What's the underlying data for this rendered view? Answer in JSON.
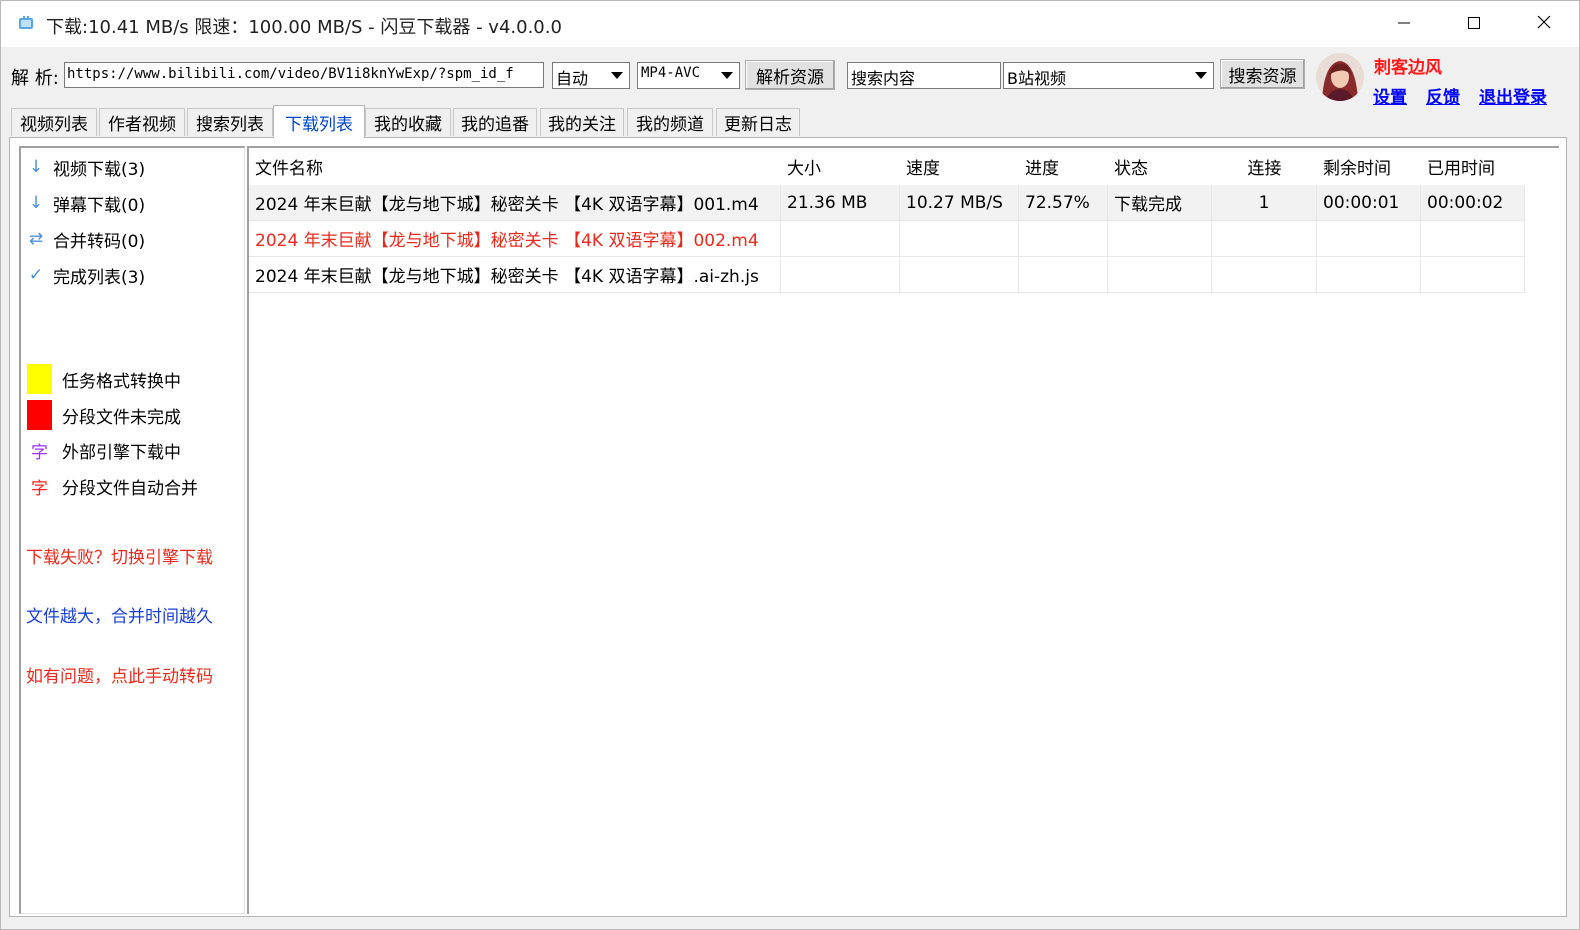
{
  "window": {
    "title": "下载:10.41 MB/s  限速：100.00 MB/S  - 闪豆下载器 - v4.0.0.0",
    "app_icon": "app-icon",
    "controls": [
      "minimize-icon",
      "maximize-icon",
      "close-icon"
    ]
  },
  "toolbar": {
    "parse_label": "解 析:",
    "url_value": "https://www.bilibili.com/video/BV1i8knYwExp/?spm_id_f",
    "mode_value": "自动",
    "format_value": "MP4-AVC",
    "parse_button": "解析资源",
    "search_placeholder": "搜索内容",
    "search_source_value": "B站视频",
    "search_button": "搜索资源"
  },
  "user": {
    "name": "刺客边风",
    "settings": "设置",
    "feedback": "反馈",
    "logout": "退出登录"
  },
  "tabs": [
    {
      "label": "视频列表"
    },
    {
      "label": "作者视频"
    },
    {
      "label": "搜索列表"
    },
    {
      "label": "下载列表",
      "active": true
    },
    {
      "label": "我的收藏"
    },
    {
      "label": "我的追番"
    },
    {
      "label": "我的关注"
    },
    {
      "label": "我的频道"
    },
    {
      "label": "更新日志"
    }
  ],
  "sidebar": {
    "items": [
      {
        "label": "视频下载(3)",
        "icon": "arrow-down-icon"
      },
      {
        "label": "弹幕下载(0)",
        "icon": "arrow-down-icon"
      },
      {
        "label": "合并转码(0)",
        "icon": "swap-icon"
      },
      {
        "label": "完成列表(3)",
        "icon": "check-icon"
      }
    ],
    "legend": [
      {
        "label": "任务格式转换中",
        "color": "#ffff00"
      },
      {
        "label": "分段文件未完成",
        "color": "#ff0000"
      },
      {
        "label": "外部引擎下载中",
        "glyph": "字",
        "color": "#9b30ff"
      },
      {
        "label": "分段文件自动合并",
        "glyph": "字",
        "color": "#ff2020"
      }
    ],
    "notes": [
      {
        "text": "下载失败？切换引擎下载",
        "color": "#e8291c"
      },
      {
        "text": "文件越大，合并时间越久",
        "color": "#1a3fd6"
      },
      {
        "text": "如有问题，点此手动转码",
        "color": "#e8291c"
      }
    ]
  },
  "table": {
    "columns": [
      "文件名称",
      "大小",
      "速度",
      "进度",
      "状态",
      "连接",
      "剩余时间",
      "已用时间"
    ],
    "rows": [
      {
        "name": "2024 年末巨献【龙与地下城】秘密关卡 【4K 双语字幕】001.m4",
        "size": "21.36 MB",
        "speed": "10.27 MB/S",
        "progress": "72.57%",
        "status": "下载完成",
        "conn": "1",
        "remaining": "00:00:01",
        "elapsed": "00:00:02"
      },
      {
        "name": "2024 年末巨献【龙与地下城】秘密关卡 【4K 双语字幕】002.m4",
        "size": "",
        "speed": "",
        "progress": "",
        "status": "",
        "conn": "",
        "remaining": "",
        "elapsed": ""
      },
      {
        "name": "2024 年末巨献【龙与地下城】秘密关卡 【4K 双语字幕】.ai-zh.js",
        "size": "",
        "speed": "",
        "progress": "",
        "status": "",
        "conn": "",
        "remaining": "",
        "elapsed": ""
      }
    ]
  }
}
